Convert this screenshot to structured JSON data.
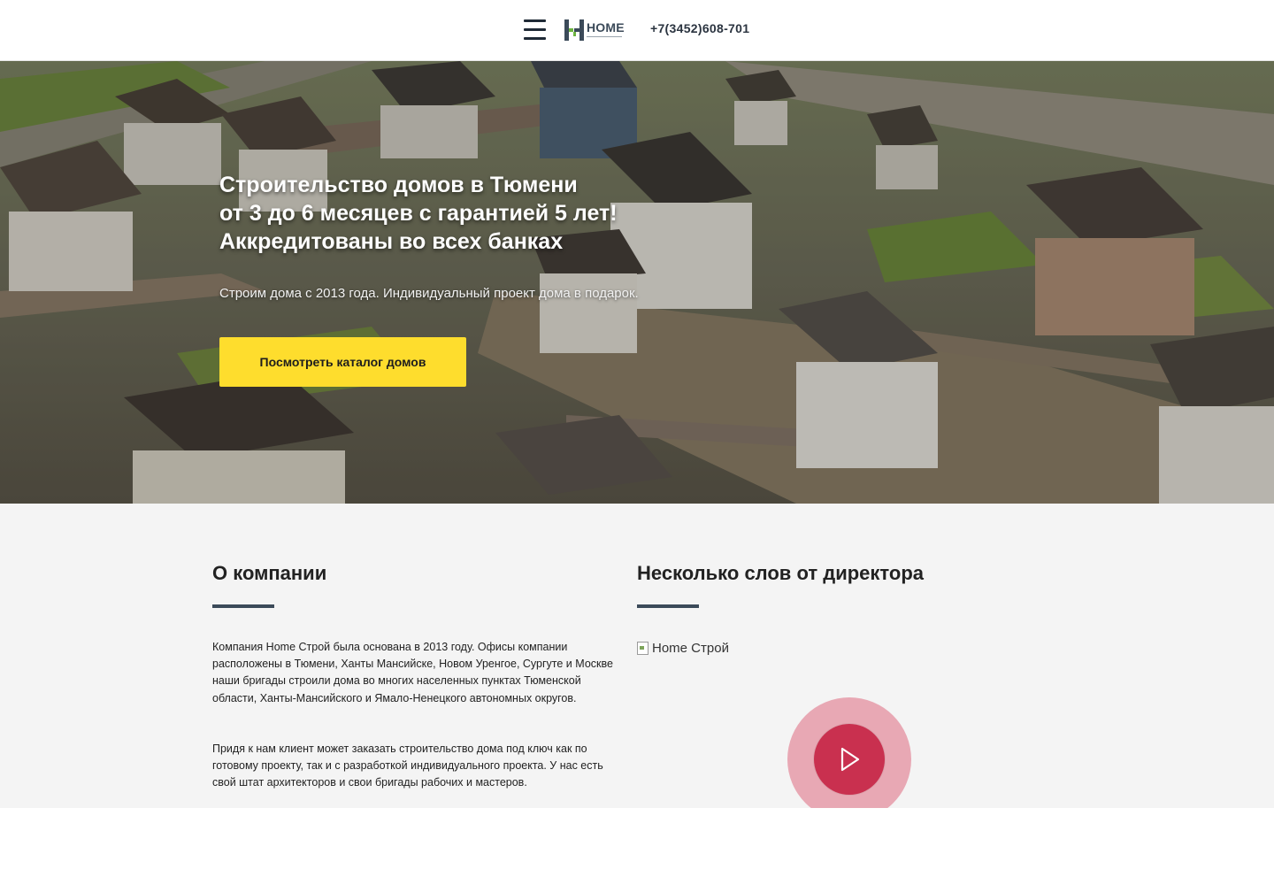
{
  "header": {
    "logo_text": "HOME",
    "phone": "+7(3452)608-701"
  },
  "hero": {
    "title": "Строительство домов в Тюмени\nот 3 до 6 месяцев с гарантией 5 лет!\nАккредитованы во всех банках",
    "subtitle": "Строим дома с 2013 года. Индивидуальный проект дома в подарок.",
    "cta_label": "Посмотреть каталог домов"
  },
  "about": {
    "title": "О компании",
    "paragraphs": [
      "Компания Home Строй была основана в 2013 году. Офисы компании расположены в Тюмени, Ханты Мансийске, Новом Уренгое, Сургуте и Москве наши бригады строили дома во многих населенных пунктах Тюменской области, Ханты-Мансийского и Ямало-Ненецкого автономных округов.",
      "Придя к нам клиент может заказать строительство дома под ключ как по готовому проекту, так и с разработкой индивидуального проекта. У нас есть свой штат архитекторов и свои бригады рабочих и мастеров."
    ]
  },
  "director": {
    "title": "Несколько слов от директора",
    "image_alt": "Home Строй"
  },
  "colors": {
    "accent_yellow": "#fedd2d",
    "dark_slate": "#3b4a59",
    "play_red": "#c9304f",
    "play_halo": "#e8a8b4"
  },
  "icons": {
    "menu": "hamburger-icon",
    "play": "play-icon",
    "broken_image": "broken-image-icon"
  }
}
